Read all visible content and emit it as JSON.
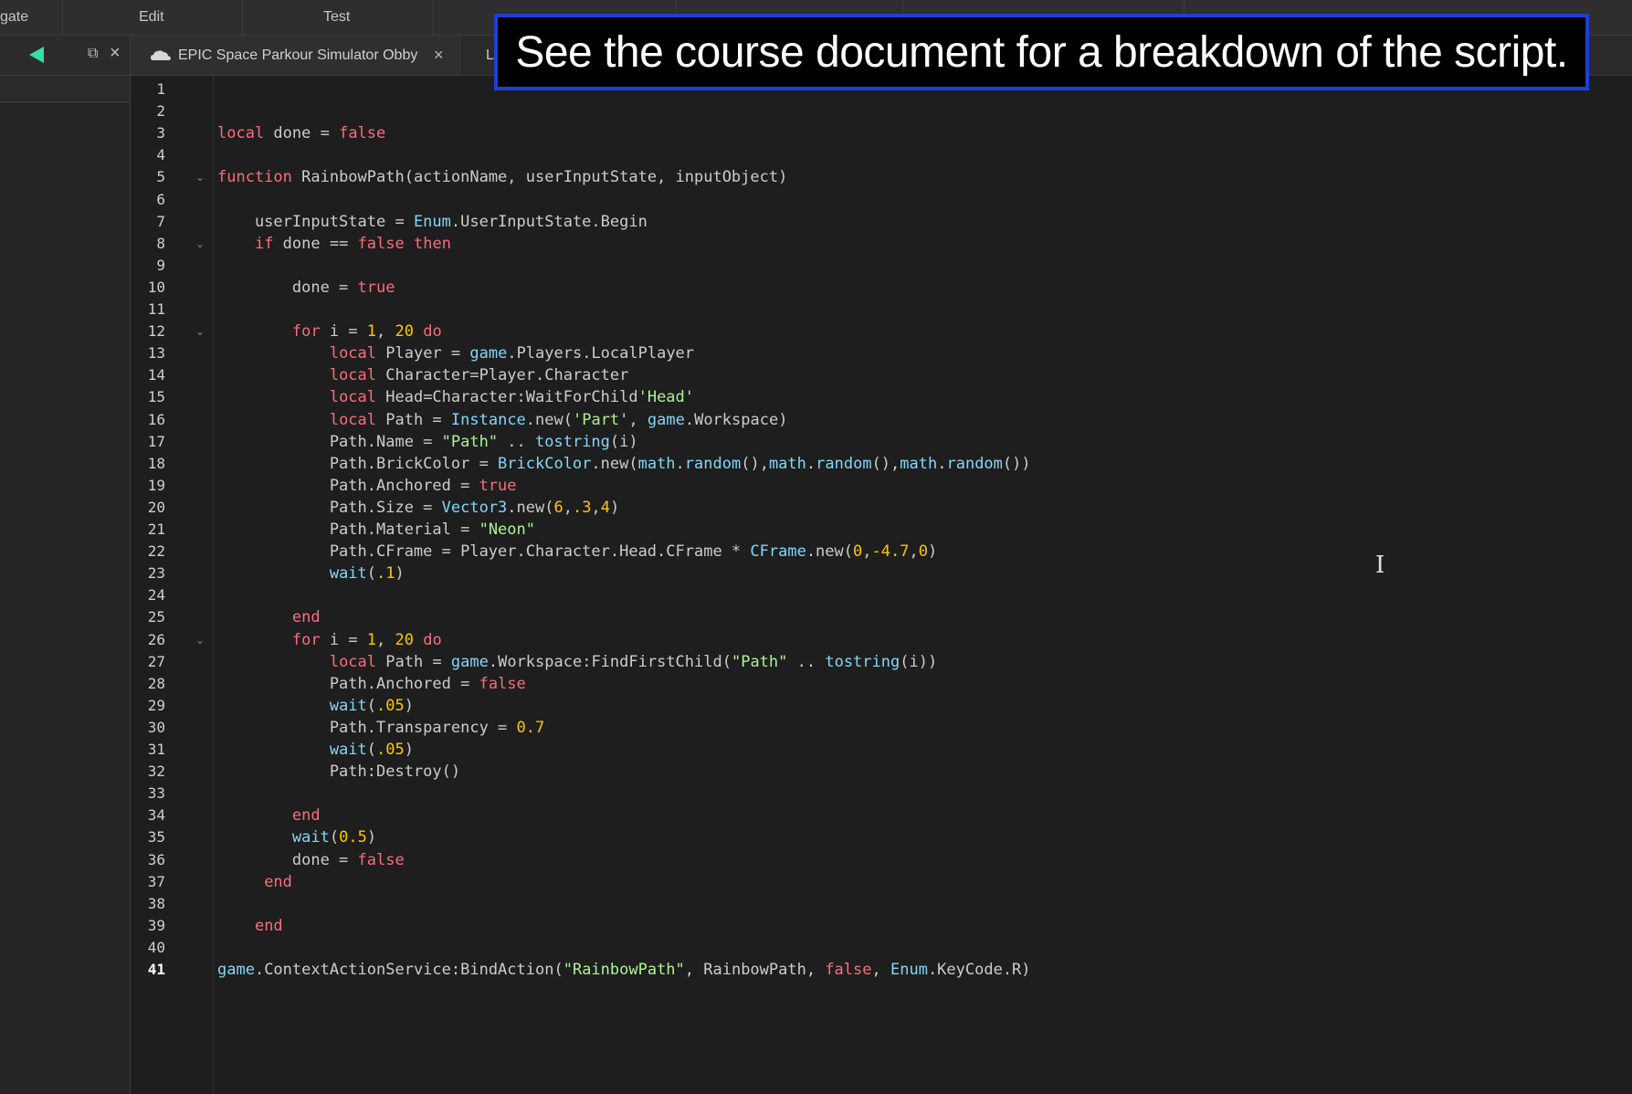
{
  "menu": {
    "items": [
      "gate",
      "Edit",
      "Test"
    ]
  },
  "tabs": {
    "script_tab_label": "EPIC Space Parkour Simulator Obby",
    "close_glyph": "×",
    "next_tab_partial": "L",
    "restore_glyph": "⧉",
    "panel_close_glyph": "×"
  },
  "caption": {
    "text": "See the course document for a breakdown of the script."
  },
  "editor": {
    "current_line": 41,
    "fold_lines": [
      5,
      8,
      12,
      26
    ],
    "fold_glyph": "⌄",
    "lines": [
      [],
      [],
      [
        [
          "kw",
          "local"
        ],
        [
          "p",
          " done = "
        ],
        [
          "kw",
          "false"
        ]
      ],
      [],
      [
        [
          "kw",
          "function"
        ],
        [
          "p",
          " RainbowPath(actionName, userInputState, inputObject)"
        ]
      ],
      [],
      [
        [
          "p",
          "    userInputState = "
        ],
        [
          "builtin",
          "Enum"
        ],
        [
          "p",
          ".UserInputState.Begin"
        ]
      ],
      [
        [
          "p",
          "    "
        ],
        [
          "kw",
          "if"
        ],
        [
          "p",
          " done == "
        ],
        [
          "kw",
          "false"
        ],
        [
          "p",
          " "
        ],
        [
          "kw",
          "then"
        ]
      ],
      [],
      [
        [
          "p",
          "        done = "
        ],
        [
          "kw",
          "true"
        ]
      ],
      [],
      [
        [
          "p",
          "        "
        ],
        [
          "kw",
          "for"
        ],
        [
          "p",
          " i = "
        ],
        [
          "num",
          "1"
        ],
        [
          "p",
          ", "
        ],
        [
          "num",
          "20"
        ],
        [
          "p",
          " "
        ],
        [
          "kw",
          "do"
        ]
      ],
      [
        [
          "p",
          "            "
        ],
        [
          "kw",
          "local"
        ],
        [
          "p",
          " Player = "
        ],
        [
          "builtin",
          "game"
        ],
        [
          "p",
          ".Players.LocalPlayer"
        ]
      ],
      [
        [
          "p",
          "            "
        ],
        [
          "kw",
          "local"
        ],
        [
          "p",
          " Character=Player.Character"
        ]
      ],
      [
        [
          "p",
          "            "
        ],
        [
          "kw",
          "local"
        ],
        [
          "p",
          " Head=Character:WaitForChild"
        ],
        [
          "str",
          "'Head'"
        ]
      ],
      [
        [
          "p",
          "            "
        ],
        [
          "kw",
          "local"
        ],
        [
          "p",
          " Path = "
        ],
        [
          "builtin",
          "Instance"
        ],
        [
          "p",
          ".new("
        ],
        [
          "str",
          "'Part'"
        ],
        [
          "p",
          ", "
        ],
        [
          "builtin",
          "game"
        ],
        [
          "p",
          ".Workspace)"
        ]
      ],
      [
        [
          "p",
          "            Path.Name = "
        ],
        [
          "str",
          "\"Path\""
        ],
        [
          "p",
          " .. "
        ],
        [
          "builtin",
          "tostring"
        ],
        [
          "p",
          "(i)"
        ]
      ],
      [
        [
          "p",
          "            Path.BrickColor = "
        ],
        [
          "builtin",
          "BrickColor"
        ],
        [
          "p",
          ".new("
        ],
        [
          "builtin",
          "math"
        ],
        [
          "p",
          "."
        ],
        [
          "builtin",
          "random"
        ],
        [
          "p",
          "(),"
        ],
        [
          "builtin",
          "math"
        ],
        [
          "p",
          "."
        ],
        [
          "builtin",
          "random"
        ],
        [
          "p",
          "(),"
        ],
        [
          "builtin",
          "math"
        ],
        [
          "p",
          "."
        ],
        [
          "builtin",
          "random"
        ],
        [
          "p",
          "())"
        ]
      ],
      [
        [
          "p",
          "            Path.Anchored = "
        ],
        [
          "kw",
          "true"
        ]
      ],
      [
        [
          "p",
          "            Path.Size = "
        ],
        [
          "builtin",
          "Vector3"
        ],
        [
          "p",
          ".new("
        ],
        [
          "num",
          "6"
        ],
        [
          "p",
          ","
        ],
        [
          "num",
          ".3"
        ],
        [
          "p",
          ","
        ],
        [
          "num",
          "4"
        ],
        [
          "p",
          ")"
        ]
      ],
      [
        [
          "p",
          "            Path.Material = "
        ],
        [
          "str",
          "\"Neon\""
        ]
      ],
      [
        [
          "p",
          "            Path.CFrame = Player.Character.Head.CFrame * "
        ],
        [
          "builtin",
          "CFrame"
        ],
        [
          "p",
          ".new("
        ],
        [
          "num",
          "0"
        ],
        [
          "p",
          ","
        ],
        [
          "num",
          "-4.7"
        ],
        [
          "p",
          ","
        ],
        [
          "num",
          "0"
        ],
        [
          "p",
          ")"
        ]
      ],
      [
        [
          "p",
          "            "
        ],
        [
          "builtin",
          "wait"
        ],
        [
          "p",
          "("
        ],
        [
          "num",
          ".1"
        ],
        [
          "p",
          ")"
        ]
      ],
      [],
      [
        [
          "p",
          "        "
        ],
        [
          "kw",
          "end"
        ]
      ],
      [
        [
          "p",
          "        "
        ],
        [
          "kw",
          "for"
        ],
        [
          "p",
          " i = "
        ],
        [
          "num",
          "1"
        ],
        [
          "p",
          ", "
        ],
        [
          "num",
          "20"
        ],
        [
          "p",
          " "
        ],
        [
          "kw",
          "do"
        ]
      ],
      [
        [
          "p",
          "            "
        ],
        [
          "kw",
          "local"
        ],
        [
          "p",
          " Path = "
        ],
        [
          "builtin",
          "game"
        ],
        [
          "p",
          ".Workspace:FindFirstChild("
        ],
        [
          "str",
          "\"Path\""
        ],
        [
          "p",
          " .. "
        ],
        [
          "builtin",
          "tostring"
        ],
        [
          "p",
          "(i))"
        ]
      ],
      [
        [
          "p",
          "            Path.Anchored = "
        ],
        [
          "kw",
          "false"
        ]
      ],
      [
        [
          "p",
          "            "
        ],
        [
          "builtin",
          "wait"
        ],
        [
          "p",
          "("
        ],
        [
          "num",
          ".05"
        ],
        [
          "p",
          ")"
        ]
      ],
      [
        [
          "p",
          "            Path.Transparency = "
        ],
        [
          "num",
          "0.7"
        ]
      ],
      [
        [
          "p",
          "            "
        ],
        [
          "builtin",
          "wait"
        ],
        [
          "p",
          "("
        ],
        [
          "num",
          ".05"
        ],
        [
          "p",
          ")"
        ]
      ],
      [
        [
          "p",
          "            Path:Destroy()"
        ]
      ],
      [],
      [
        [
          "p",
          "        "
        ],
        [
          "kw",
          "end"
        ]
      ],
      [
        [
          "p",
          "        "
        ],
        [
          "builtin",
          "wait"
        ],
        [
          "p",
          "("
        ],
        [
          "num",
          "0.5"
        ],
        [
          "p",
          ")"
        ]
      ],
      [
        [
          "p",
          "        done = "
        ],
        [
          "kw",
          "false"
        ]
      ],
      [
        [
          "p",
          "     "
        ],
        [
          "kw",
          "end"
        ]
      ],
      [],
      [
        [
          "p",
          "    "
        ],
        [
          "kw",
          "end"
        ]
      ],
      [],
      [
        [
          "builtin",
          "game"
        ],
        [
          "p",
          ".ContextActionService:BindAction("
        ],
        [
          "str",
          "\"RainbowPath\""
        ],
        [
          "p",
          ", RainbowPath, "
        ],
        [
          "kw",
          "false"
        ],
        [
          "p",
          ", "
        ],
        [
          "builtin",
          "Enum"
        ],
        [
          "p",
          ".KeyCode.R)"
        ]
      ]
    ]
  },
  "colors": {
    "keyword": "#f86d7c",
    "builtin": "#84d6f7",
    "number": "#ffc600",
    "string": "#adf195",
    "plain": "#cccccc",
    "caption_border": "#1e3fd6",
    "play_accent": "#34e0a1"
  },
  "icons": {
    "play": "play-icon",
    "cloud": "cloud-icon",
    "restore": "restore-window-icon",
    "close": "close-icon",
    "fold": "chevron-down-icon",
    "text_cursor": "i-beam-cursor-icon"
  },
  "cursor_glyph": "I"
}
